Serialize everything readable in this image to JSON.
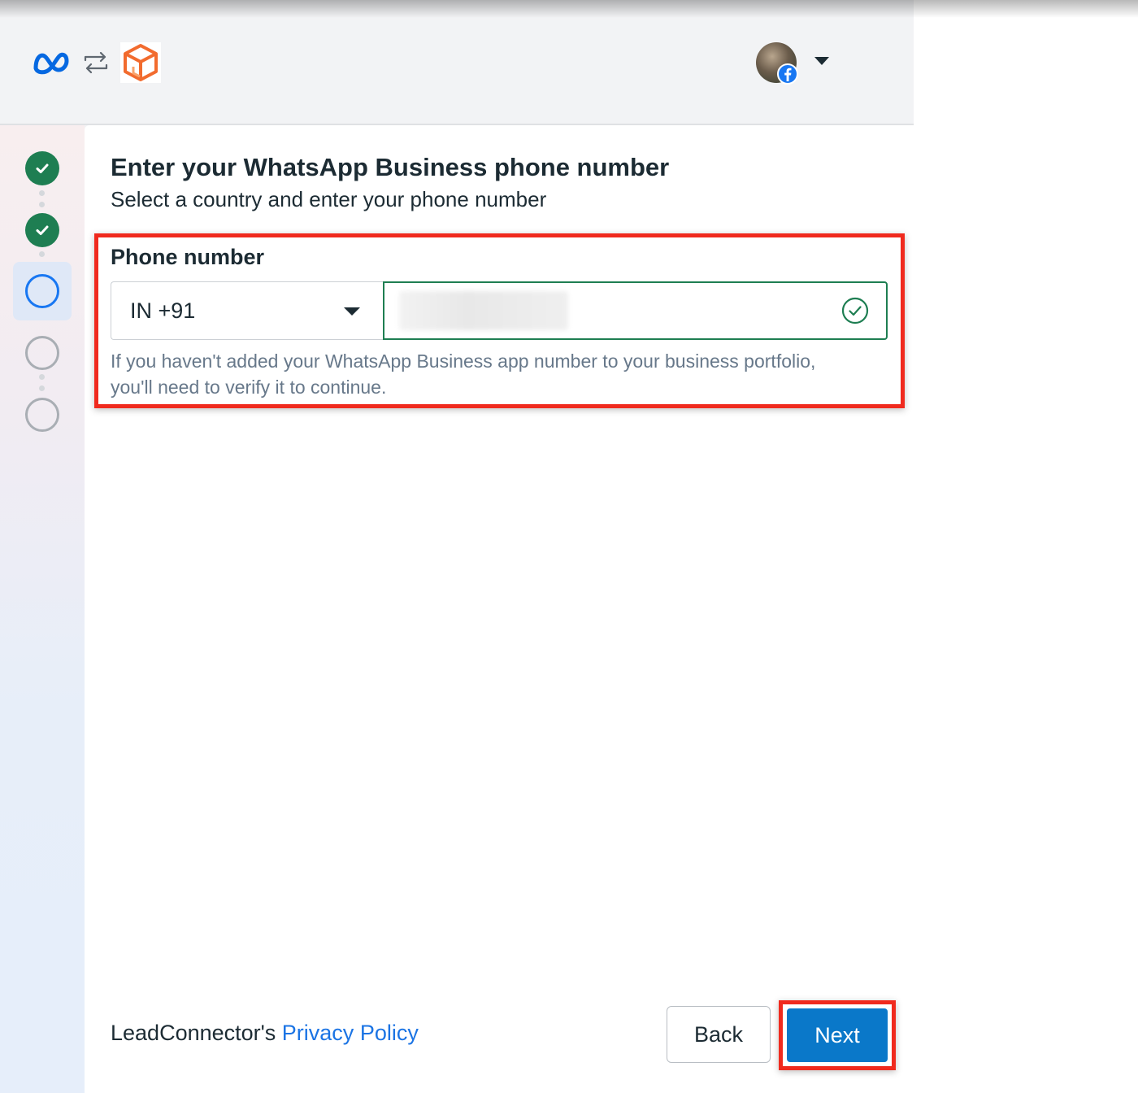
{
  "header": {
    "logos": [
      "meta-logo",
      "sync-arrows-icon",
      "leadconnector-logo"
    ],
    "account": {
      "avatar": "user-avatar",
      "badge_icon": "facebook-icon",
      "menu_icon": "caret-down-icon"
    }
  },
  "stepper": {
    "steps": [
      {
        "state": "completed",
        "icon": "check-icon"
      },
      {
        "state": "completed",
        "icon": "check-icon"
      },
      {
        "state": "current",
        "icon": "circle-icon"
      },
      {
        "state": "upcoming",
        "icon": "circle-icon"
      },
      {
        "state": "upcoming",
        "icon": "circle-icon"
      }
    ]
  },
  "main": {
    "title": "Enter your WhatsApp Business phone number",
    "subtitle": "Select a country and enter your phone number",
    "phone_field": {
      "label": "Phone number",
      "country_value": "IN +91",
      "number_value": "•••••••••••",
      "number_redacted": true,
      "valid_icon": "check-circle-icon",
      "helper": "If you haven't added your WhatsApp Business app number to your business portfolio, you'll need to verify it to continue."
    }
  },
  "footer": {
    "company": "LeadConnector's",
    "privacy_link": "Privacy Policy",
    "back_label": "Back",
    "next_label": "Next"
  },
  "colors": {
    "meta_blue": "#0668e1",
    "success_green": "#1e7e52",
    "current_step_blue": "#1877f2",
    "primary_button": "#0a78c9",
    "link_blue": "#1b74e4",
    "annotation_red": "#f02a1e",
    "app_logo_orange": "#f26b2e"
  }
}
